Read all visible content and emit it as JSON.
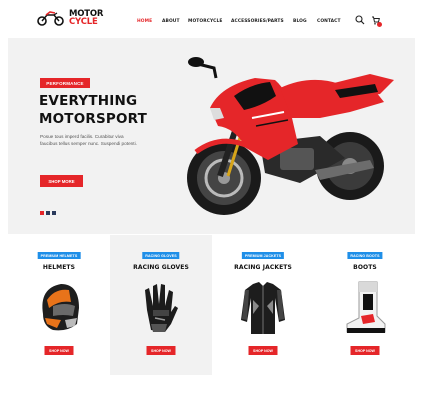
{
  "logo": {
    "line1": "MOTOR",
    "line2": "CYCLE"
  },
  "nav": {
    "items": [
      {
        "label": "HOME",
        "active": true
      },
      {
        "label": "ABOUT"
      },
      {
        "label": "MOTORCYCLE"
      },
      {
        "label": "ACCESSORIES/PARTS"
      },
      {
        "label": "BLOG"
      },
      {
        "label": "CONTACT"
      }
    ],
    "icons": [
      "search-icon",
      "cart-icon"
    ]
  },
  "hero": {
    "badge": "PERFORMANCE",
    "title_line1": "EVERYTHING",
    "title_line2": "MOTORSPORT",
    "description": "Posue tous imperd facilis. Curabitur viva faucibus tellus semper nunc. Suspendi potenti.",
    "button": "SHOP MORE",
    "slide_count": 3,
    "active_slide": 1
  },
  "products": [
    {
      "tag": "PREMIUM HELMETS",
      "name": "HELMETS",
      "button": "SHOP NOW",
      "image": "helmet"
    },
    {
      "tag": "RACING GLOVES",
      "name": "RACING GLOVES",
      "button": "SHOP NOW",
      "image": "gloves"
    },
    {
      "tag": "PREMIUM JACKETS",
      "name": "RACING JACKETS",
      "button": "SHOP NOW",
      "image": "jacket"
    },
    {
      "tag": "RACING BOOTS",
      "name": "BOOTS",
      "button": "SHOP NOW",
      "image": "boot"
    }
  ],
  "colors": {
    "accent": "#e52629",
    "tag_blue": "#1f8fe8",
    "hero_bg": "#f2f2f2",
    "slide_dot_inactive": "#2a3a5c"
  }
}
